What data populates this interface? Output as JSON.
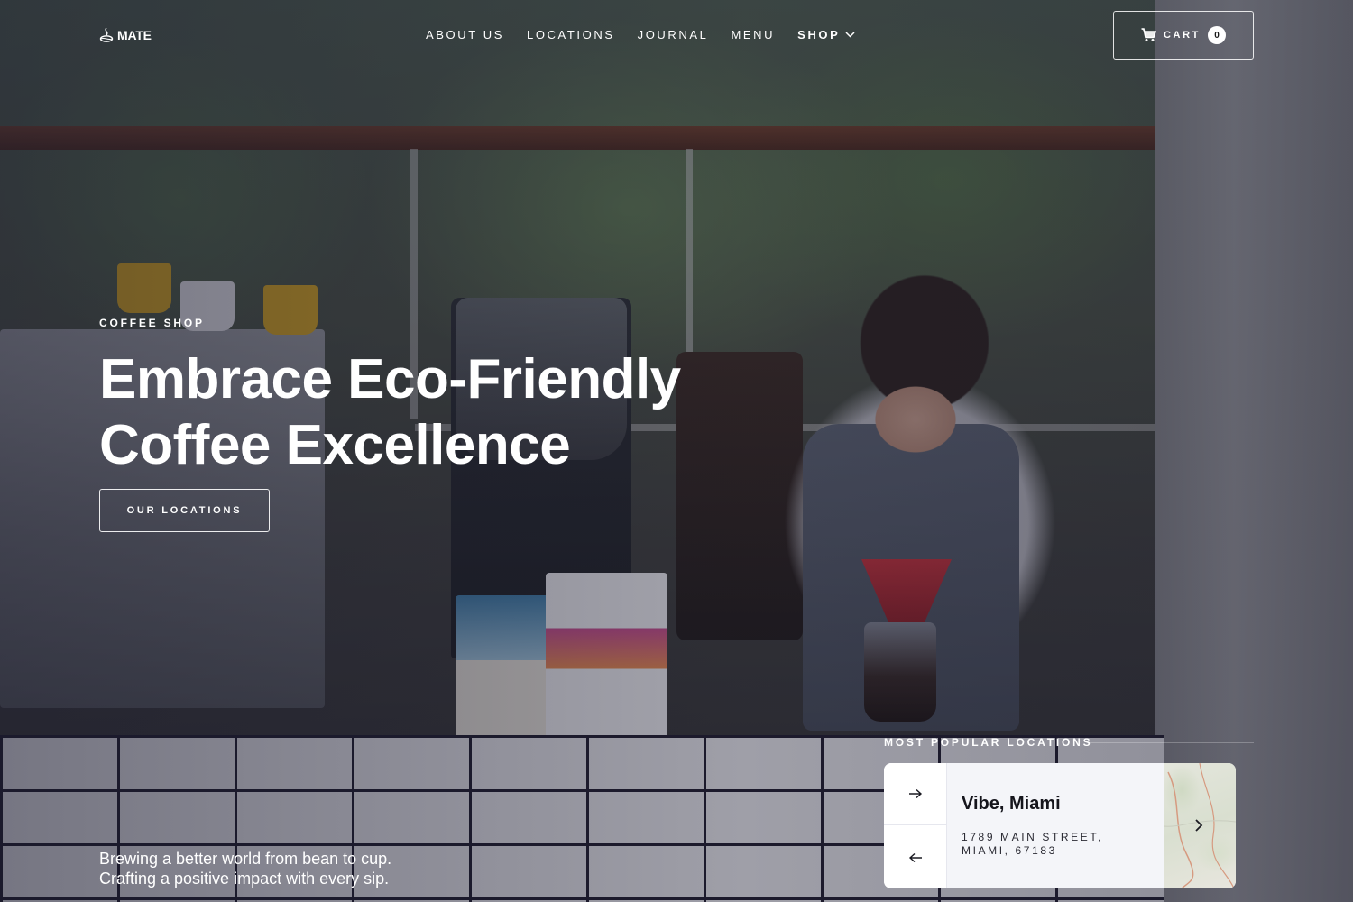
{
  "brand": {
    "name": "MATE"
  },
  "nav": {
    "items": [
      {
        "label": "ABOUT US"
      },
      {
        "label": "LOCATIONS"
      },
      {
        "label": "JOURNAL"
      },
      {
        "label": "MENU"
      },
      {
        "label": "SHOP",
        "has_dropdown": true
      }
    ]
  },
  "cart": {
    "label": "CART",
    "count": "0",
    "icon": "cart-icon"
  },
  "hero": {
    "eyebrow": "COFFEE SHOP",
    "headline_line1": "Embrace Eco-Friendly",
    "headline_line2": "Coffee Excellence",
    "cta_label": "OUR LOCATIONS",
    "tagline_line1": "Brewing a better world from bean to cup.",
    "tagline_line2": "Crafting a positive impact with every sip."
  },
  "locations": {
    "heading": "MOST POPULAR LOCATIONS",
    "current": {
      "name": "Vibe, Miami",
      "address_line1": "1789 MAIN STREET,",
      "address_line2": "MIAMI, 67183"
    },
    "next_icon": "arrow-right-icon",
    "prev_icon": "arrow-left-icon",
    "map_icon": "chevron-right-icon"
  },
  "colors": {
    "card_bg": "#f4f5f9",
    "text_dark": "#15151c",
    "overlay": "#19192d"
  }
}
